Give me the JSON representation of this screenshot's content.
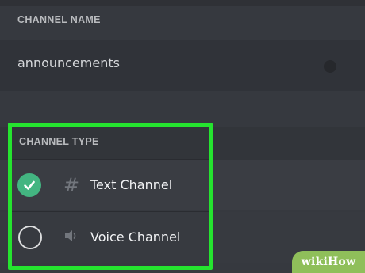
{
  "channel_name_section": {
    "label": "CHANNEL NAME",
    "value": "announcements"
  },
  "channel_type_section": {
    "label": "CHANNEL TYPE",
    "options": [
      {
        "label": "Text Channel",
        "icon": "hash-icon",
        "selected": true
      },
      {
        "label": "Voice Channel",
        "icon": "speaker-icon",
        "selected": false
      }
    ]
  },
  "colors": {
    "background": "#36393f",
    "highlight": "#25e42f",
    "selected_radio": "#43b581",
    "watermark": "#8fbf5a"
  },
  "watermark": {
    "text": "wikiHow"
  }
}
